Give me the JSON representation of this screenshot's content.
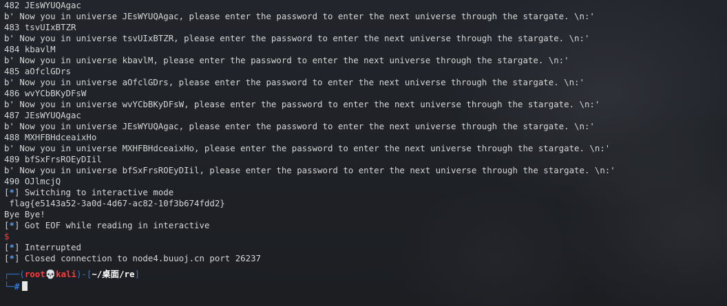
{
  "output_lines": [
    {
      "text": "482 JEsWYUQAgac"
    },
    {
      "text": "b' Now you in universe JEsWYUQAgac, please enter the password to enter the next universe through the stargate. \\n:'"
    },
    {
      "text": "483 tsvUIxBTZR"
    },
    {
      "text": "b' Now you in universe tsvUIxBTZR, please enter the password to enter the next universe through the stargate. \\n:'"
    },
    {
      "text": "484 kbavlM"
    },
    {
      "text": "b' Now you in universe kbavlM, please enter the password to enter the next universe through the stargate. \\n:'"
    },
    {
      "text": "485 aOfclGDrs"
    },
    {
      "text": "b' Now you in universe aOfclGDrs, please enter the password to enter the next universe through the stargate. \\n:'"
    },
    {
      "text": "486 wvYCbBKyDFsW"
    },
    {
      "text": "b' Now you in universe wvYCbBKyDFsW, please enter the password to enter the next universe through the stargate. \\n:'"
    },
    {
      "text": "487 JEsWYUQAgac"
    },
    {
      "text": "b' Now you in universe JEsWYUQAgac, please enter the password to enter the next universe through the stargate. \\n:'"
    },
    {
      "text": "488 MXHFBHdceaixHo"
    },
    {
      "text": "b' Now you in universe MXHFBHdceaixHo, please enter the password to enter the next universe through the stargate. \\n:'"
    },
    {
      "text": "489 bfSxFrsROEyDIil"
    },
    {
      "text": "b' Now you in universe bfSxFrsROEyDIil, please enter the password to enter the next universe through the stargate. \\n:'"
    },
    {
      "text": "490 OJlmcjQ"
    }
  ],
  "status_switching": "Switching to interactive mode",
  "flag_line": " flag{e5143a52-3a0d-4d67-ac82-10f3b674fdd2}",
  "bye_line": "Bye Bye!",
  "status_eof": "Got EOF while reading in interactive",
  "dollar_prompt": "$",
  "status_interrupted": "Interrupted",
  "status_closed": "Closed connection to node4.buuoj.cn port 26237",
  "star_marker": "*",
  "prompt": {
    "frame_top": "┌──(",
    "user": "root💀kali",
    "frame_mid": ")-[",
    "path": "~/桌面/re",
    "frame_end": "]",
    "frame_bottom": "└─",
    "hash": "#"
  },
  "colors": {
    "background": "#1d1f24",
    "text": "#d6d6d6",
    "status_star": "#4aa3ff",
    "prompt_red": "#ff3b3b",
    "prompt_frame": "#2f7bdc"
  }
}
